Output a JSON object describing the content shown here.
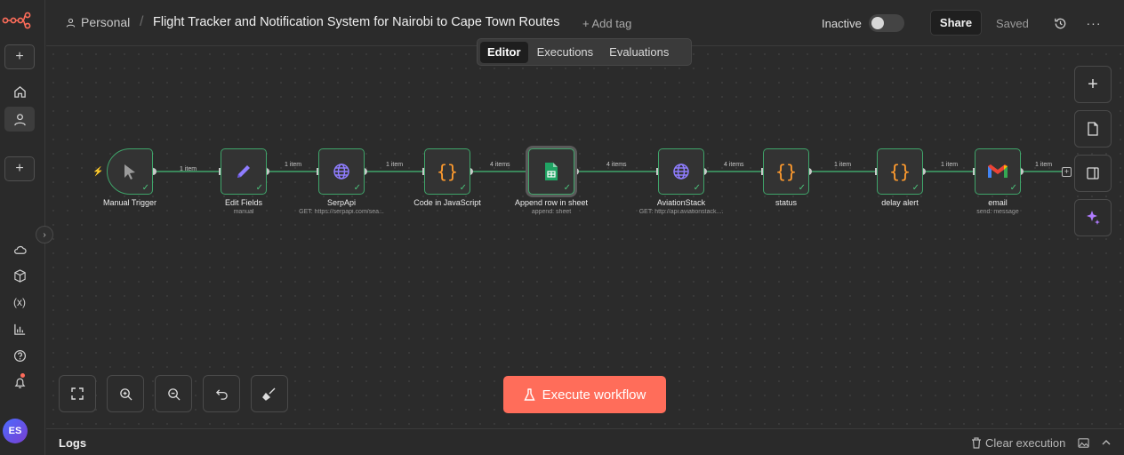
{
  "header": {
    "project": "Personal",
    "title": "Flight Tracker and Notification System for Nairobi to Cape Town Routes",
    "add_tag": "+ Add tag",
    "status_label": "Inactive",
    "share_label": "Share",
    "saved_label": "Saved"
  },
  "tabs": [
    {
      "label": "Editor",
      "active": true
    },
    {
      "label": "Executions",
      "active": false
    },
    {
      "label": "Evaluations",
      "active": false
    }
  ],
  "sidebar": {
    "avatar_initials": "ES",
    "items": [
      "add",
      "home",
      "personal",
      "create",
      "cloud",
      "templates",
      "variables",
      "insights",
      "help",
      "notifications"
    ]
  },
  "nodes": [
    {
      "name": "Manual Trigger",
      "sub": "",
      "icon": "cursor-icon"
    },
    {
      "name": "Edit Fields",
      "sub": "manual",
      "icon": "pencil-icon"
    },
    {
      "name": "SerpApi",
      "sub": "GET: https://serpapi.com/sea...",
      "icon": "globe-icon"
    },
    {
      "name": "Code in JavaScript",
      "sub": "",
      "icon": "braces-icon"
    },
    {
      "name": "Append row in sheet",
      "sub": "append: sheet",
      "icon": "google-sheets-icon"
    },
    {
      "name": "AviationStack",
      "sub": "GET: http://api.aviationstack....",
      "icon": "globe-icon"
    },
    {
      "name": "status",
      "sub": "",
      "icon": "braces-icon"
    },
    {
      "name": "delay alert",
      "sub": "",
      "icon": "braces-icon"
    },
    {
      "name": "email",
      "sub": "send: message",
      "icon": "gmail-icon"
    }
  ],
  "edges": [
    "1 item",
    "1 item",
    "1 item",
    "4 items",
    "4 items",
    "4 items",
    "1 item",
    "1 item",
    "1 item"
  ],
  "canvas": {
    "execute_label": "Execute workflow"
  },
  "logs": {
    "title": "Logs",
    "clear_label": "Clear execution"
  },
  "colors": {
    "accent": "#ff6d5a",
    "node_border": "#3fa56a",
    "connection": "#3fa56a"
  }
}
